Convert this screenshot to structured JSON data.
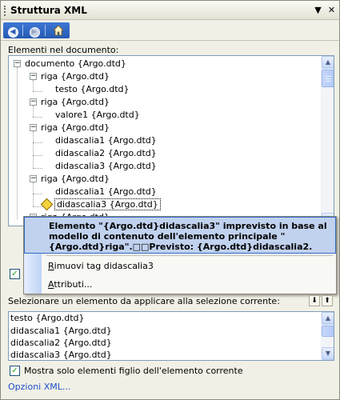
{
  "pane": {
    "title": "Struttura XML",
    "dropdown_glyph": "▼",
    "close_glyph": "✕"
  },
  "nav": {
    "back_icon": "back-icon",
    "forward_icon": "forward-icon",
    "home_icon": "home-icon"
  },
  "tree": {
    "label": "Elementi nel documento:",
    "nodes": [
      "documento {Argo.dtd}",
      "riga {Argo.dtd}",
      "testo {Argo.dtd}",
      "riga {Argo.dtd}",
      "valore1 {Argo.dtd}",
      "riga {Argo.dtd}",
      "didascalia1 {Argo.dtd}",
      "didascalia2 {Argo.dtd}",
      "didascalia3 {Argo.dtd}",
      "riga {Argo.dtd}",
      "didascalia1 {Argo.dtd}",
      "didascalia3 {Argo.dtd}",
      "riga {Argo.dtd}"
    ]
  },
  "popup": {
    "message": "Elemento \"{Argo.dtd}didascalia3\" imprevisto in base al modello di contenuto dell'elemento principale \"{Argo.dtd}riga\".□□Previsto: {Argo.dtd}didascalia2.",
    "remove_tag": "Rimuovi tag didascalia3",
    "attributes": "Attributi..."
  },
  "apply": {
    "label": "Selezionare un elemento da applicare alla selezione corrente:",
    "items": [
      "testo {Argo.dtd}",
      "didascalia1 {Argo.dtd}",
      "didascalia2 {Argo.dtd}",
      "didascalia3 {Argo.dtd}"
    ]
  },
  "filter_checkbox": {
    "label": "Mostra solo elementi figlio dell'elemento corrente",
    "checked": true
  },
  "options_link": "Opzioni XML...",
  "colors": {
    "pane_bg": "#F1F0E6",
    "nav_blue": "#255AB3",
    "popup_highlight": "#C1D2EE",
    "link": "#1C4FC9",
    "warning": "#F5D33B"
  }
}
